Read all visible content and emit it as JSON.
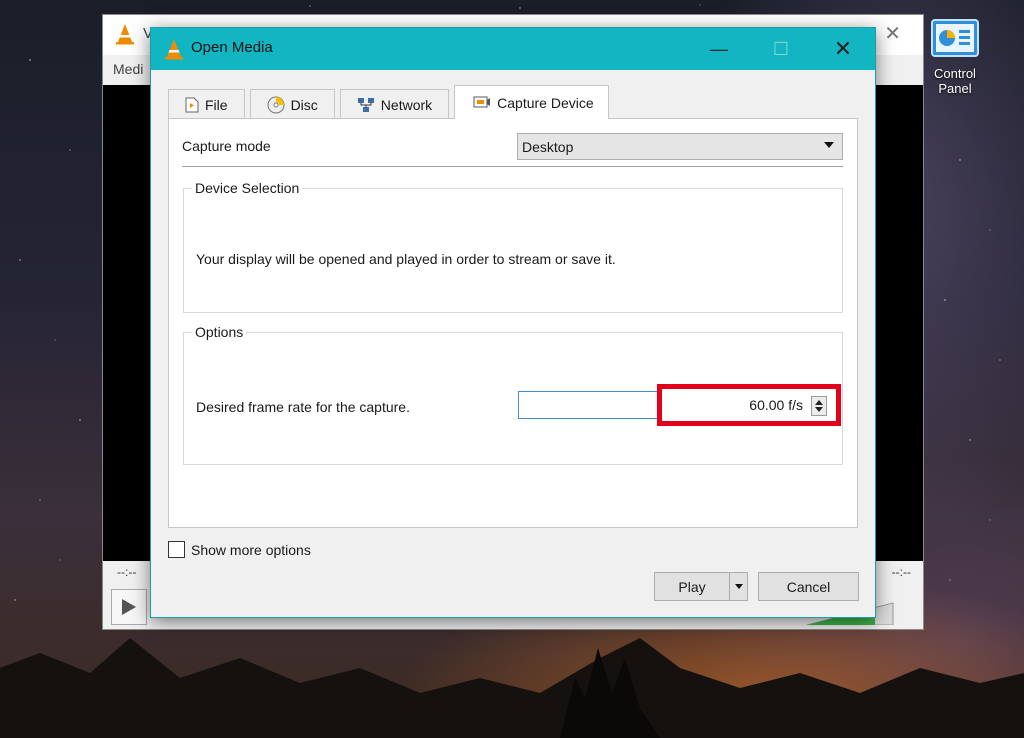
{
  "desktop": {
    "icon_label": "Control\nPanel",
    "icon": "control-panel-icon"
  },
  "vlc_main": {
    "title_partial": "V",
    "menu_partial": "Medi",
    "time_elapsed": "--:--",
    "time_total": "--:--"
  },
  "dialog": {
    "title": "Open Media",
    "tabs": [
      {
        "label": "File",
        "icon": "file-icon"
      },
      {
        "label": "Disc",
        "icon": "disc-icon"
      },
      {
        "label": "Network",
        "icon": "network-icon"
      },
      {
        "label": "Capture Device",
        "icon": "capture-device-icon",
        "active": true
      }
    ],
    "capture_mode_label": "Capture mode",
    "capture_mode_value": "Desktop",
    "device_selection_legend": "Device Selection",
    "device_selection_text": "Your display will be opened and played in order to stream or save it.",
    "options_legend": "Options",
    "frame_rate_label": "Desired frame rate for the capture.",
    "frame_rate_value": "60.00 f/s",
    "show_more_options": "Show more options",
    "play_label": "Play",
    "cancel_label": "Cancel"
  },
  "colors": {
    "title_bar": "#12b6c2",
    "highlight": "#e3001b"
  }
}
